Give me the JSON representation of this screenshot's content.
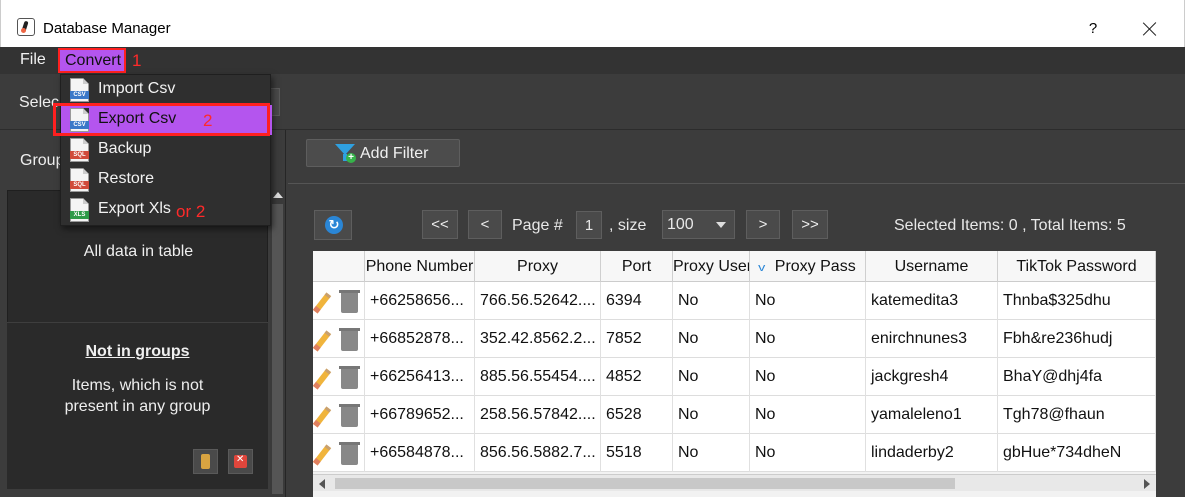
{
  "window": {
    "title": "Database Manager",
    "help_label": "?"
  },
  "menubar": {
    "file_label": "File",
    "convert_label": "Convert"
  },
  "annotations": {
    "convert_marker": "1",
    "export_marker": "2",
    "xls_marker": "or 2",
    "color": "#ff2020"
  },
  "convert_menu": {
    "items": [
      {
        "label": "Import Csv",
        "icon": "csv-file-icon",
        "tag": "CSV",
        "tag_color": "#3a78c8"
      },
      {
        "label": "Export Csv",
        "icon": "csv-file-icon",
        "tag": "CSV",
        "tag_color": "#3a78c8",
        "highlighted": true
      },
      {
        "label": "Backup",
        "icon": "sql-file-icon",
        "tag": "SQL",
        "tag_color": "#d04a3a"
      },
      {
        "label": "Restore",
        "icon": "sql-file-icon",
        "tag": "SQL",
        "tag_color": "#d04a3a"
      },
      {
        "label": "Export Xls",
        "icon": "xls-file-icon",
        "tag": "XLS",
        "tag_color": "#2e9a48"
      }
    ],
    "highlight_color": "#b455ee"
  },
  "toolbar": {
    "select_label": "Selec"
  },
  "left_panel": {
    "group_label": "Group",
    "all_data_label": "All data in table",
    "not_in_groups_title": "Not in groups",
    "not_in_groups_desc_line1": "Items, which is not",
    "not_in_groups_desc_line2": "present in any group"
  },
  "filter": {
    "add_filter_label": "Add Filter"
  },
  "pager": {
    "first_label": "<<",
    "prev_label": "<",
    "page_label": "Page #",
    "page_value": "1",
    "size_label": ", size",
    "size_value": "100",
    "next_label": ">",
    "last_label": ">>",
    "selected_total": "Selected Items:  0  ,  Total Items:  5"
  },
  "table": {
    "columns": [
      "",
      "Phone Number",
      "Proxy",
      "Port",
      "Proxy User",
      "Proxy Pass",
      "Username",
      "TikTok Password"
    ],
    "rows": [
      [
        "+66258656...",
        "766.56.52642....",
        "6394",
        "No",
        "No",
        "katemedita3",
        "Thnba$325dhu"
      ],
      [
        "+66852878...",
        "352.42.8562.2...",
        "7852",
        "No",
        "No",
        "enirchnunes3",
        "Fbh&re236hudj"
      ],
      [
        "+66256413...",
        "885.56.55454....",
        "4852",
        "No",
        "No",
        "jackgresh4",
        "BhaY@dhj4fa"
      ],
      [
        "+66789652...",
        "258.56.57842....",
        "6528",
        "No",
        "No",
        "yamaleleno1",
        "Tgh78@fhaun"
      ],
      [
        "+66584878...",
        "856.56.5882.7...",
        "5518",
        "No",
        "No",
        "lindaderby2",
        "gbHue*734dheN"
      ]
    ]
  }
}
